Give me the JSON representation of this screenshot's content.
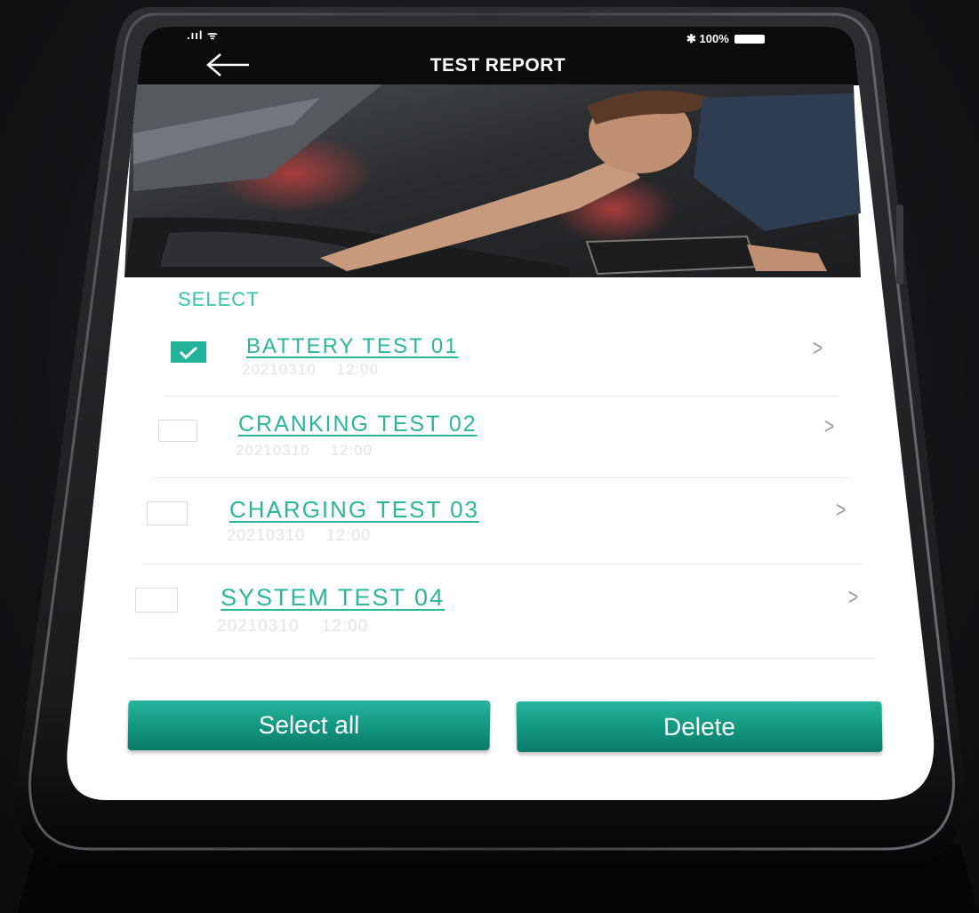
{
  "status_bar": {
    "signal_wifi": ".ııl ᯤ",
    "bluetooth_battery": "✱ 100%"
  },
  "header": {
    "title": "TEST REPORT",
    "back_icon": "arrow-left-icon"
  },
  "hero": {
    "subject": "mechanic-inspecting-engine-photo"
  },
  "list": {
    "section_label": "SELECT",
    "items": [
      {
        "title": "BATTERY TEST 01",
        "date": "20210310",
        "time": "12:00",
        "checked": true,
        "chevron": ">"
      },
      {
        "title": "CRANKING TEST 02",
        "date": "20210310",
        "time": "12:00",
        "checked": false,
        "chevron": ">"
      },
      {
        "title": "CHARGING TEST 03",
        "date": "20210310",
        "time": "12:00",
        "checked": false,
        "chevron": ">"
      },
      {
        "title": "SYSTEM TEST 04",
        "date": "20210310",
        "time": "12:00",
        "checked": false,
        "chevron": ">"
      }
    ]
  },
  "actions": {
    "select_all_label": "Select all",
    "delete_label": "Delete"
  },
  "colors": {
    "accent": "#2bb69c",
    "button": "#12957f",
    "header_bg": "#0c0c0e"
  }
}
